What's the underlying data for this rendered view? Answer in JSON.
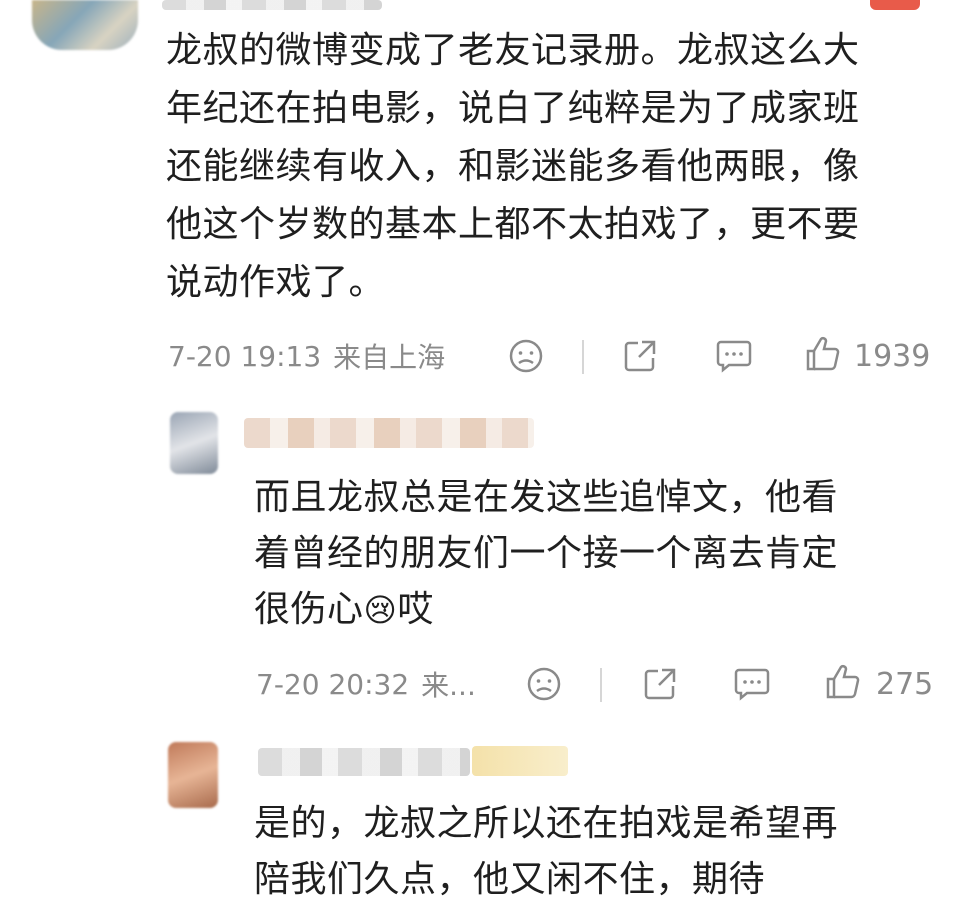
{
  "comments": [
    {
      "text_lines": [
        "龙叔的微博变成了老友记录册。龙叔这么大",
        "年纪还在拍电影，说白了纯粹是为了成家班",
        "还能继续有收入，和影迷能多看他两眼，像",
        "他这个岁数的基本上都不太拍戏了，更不要",
        "说动作戏了。"
      ],
      "timestamp": "7-20 19:13",
      "location": "来自上海",
      "likes": "1939"
    },
    {
      "text_lines": [
        "而且龙叔总是在发这些追悼文，他看",
        "着曾经的朋友们一个接一个离去肯定",
        "很伤心"
      ],
      "emoji_suffix": "😢",
      "tail": "哎",
      "timestamp": "7-20 20:32",
      "location": "来...",
      "likes": "275"
    },
    {
      "text_lines": [
        "是的，龙叔之所以还在拍戏是希望再",
        "陪我们久点，他又闲不住，期待"
      ]
    }
  ],
  "colors": {
    "meta": "#8a8a8a",
    "text": "#1f1f1f",
    "divider": "#d6d6d6"
  }
}
